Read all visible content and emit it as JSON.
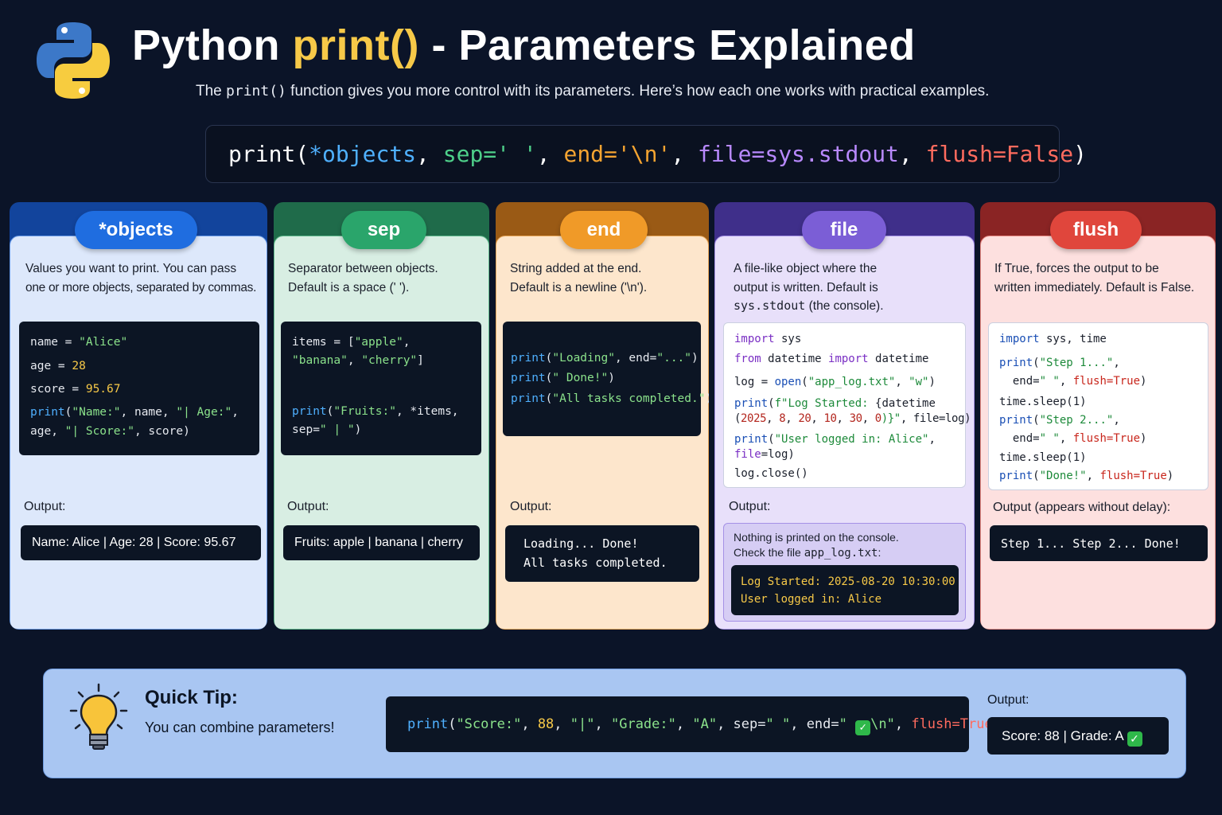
{
  "header": {
    "title_prefix": "Python ",
    "title_highlight": "print()",
    "title_suffix": " - Parameters Explained",
    "subtitle_pre": "The ",
    "subtitle_code": "print()",
    "subtitle_post": " function gives you more control with its parameters. Here’s how each one works with practical examples."
  },
  "signature": {
    "fn": "print(",
    "p1": "*objects",
    "c1": ", ",
    "p2": "sep=' '",
    "c2": ", ",
    "p3": "end='\\n'",
    "c3": ", ",
    "p4a": "file",
    "p4b": "=sys.stdout",
    "c4": ", ",
    "p5a": "flush",
    "p5b": "=False",
    "close": ")"
  },
  "cards": {
    "objects": {
      "label": "*objects",
      "desc1": "Values you want to print. You can pass",
      "desc2": "one or more objects, separated by commas.",
      "output_label": "Output:",
      "output": "Name: Alice | Age: 28 | Score: 95.67",
      "code": {
        "l1a": "name = ",
        "l1b": "\"Alice\"",
        "l2a": "age = ",
        "l2b": "28",
        "l3a": "score = ",
        "l3b": "95.67",
        "l4a": "print",
        "l4b": "(",
        "l4c": "\"Name:\"",
        "l4d": ", name, ",
        "l4e": "\"| Age:\"",
        "l4f": ",",
        "l5a": "age, ",
        "l5b": "\"| Score:\"",
        "l5c": ", score)"
      }
    },
    "sep": {
      "label": "sep",
      "desc1": "Separator between objects.",
      "desc2": "Default is a space (' ').",
      "output_label": "Output:",
      "output": "Fruits: apple | banana | cherry",
      "code": {
        "l1a": "items = [",
        "l1b": "\"apple\"",
        "l1c": ",",
        "l2a": "\"banana\"",
        "l2b": ", ",
        "l2c": "\"cherry\"",
        "l2d": "]",
        "l3a": "print",
        "l3b": "(",
        "l3c": "\"Fruits:\"",
        "l3d": ", *items,",
        "l4a": "sep=",
        "l4b": "\" | \"",
        "l4c": ")"
      }
    },
    "end": {
      "label": "end",
      "desc1": "String added at the end.",
      "desc2": "Default is a newline ('\\n').",
      "output_label": "Output:",
      "output1": "Loading... Done!",
      "output2": "All tasks completed.",
      "code": {
        "l1a": "print",
        "l1b": "(",
        "l1c": "\"Loading\"",
        "l1d": ", end=",
        "l1e": "\"...\"",
        "l1f": ")",
        "l2a": "print",
        "l2b": "(",
        "l2c": "\" Done!\"",
        "l2d": ")",
        "l3a": "print",
        "l3b": "(",
        "l3c": "\"All tasks completed.\"",
        "l3d": ")"
      }
    },
    "file": {
      "label": "file",
      "desc1": "A file-like object where the",
      "desc2": "output is written. Default is",
      "desc3a": "sys.stdout",
      "desc3b": " (the console).",
      "output_label": "Output:",
      "note1": "Nothing is printed on the console.",
      "note2a": "Check the file ",
      "note2b": "app_log.txt",
      "note2c": ":",
      "log1": "Log Started: 2025-08-20 10:30:00",
      "log2": "User logged in: Alice",
      "code": {
        "l1a": "import",
        "l1b": " sys",
        "l2a": "from",
        "l2b": " datetime ",
        "l2c": "import",
        "l2d": " datetime",
        "l3a": "log = ",
        "l3b": "open",
        "l3c": "(",
        "l3d": "\"app_log.txt\"",
        "l3e": ", ",
        "l3f": "\"w\"",
        "l3g": ")",
        "l4a": "print",
        "l4b": "(",
        "l4c": "f\"Log Started: ",
        "l4d": "{datetime",
        "l5a": "(",
        "l5b": "2025",
        "l5c": ", ",
        "l5d": "8",
        "l5e": ", ",
        "l5f": "20",
        "l5g": ", ",
        "l5h": "10",
        "l5i": ", ",
        "l5j": "30",
        "l5k": ", ",
        "l5l": "0",
        "l5m": ")}\"",
        "l5n": ", file=log)",
        "l6a": "print",
        "l6b": "(",
        "l6c": "\"User logged in: Alice\"",
        "l6d": ",",
        "l7a": "file",
        "l7b": "=log)",
        "l8a": "log.close()"
      }
    },
    "flush": {
      "label": "flush",
      "desc1": "If True, forces the output to be",
      "desc2": "written immediately. Default is False.",
      "output_label": "Output (appears without delay):",
      "output": "Step 1... Step 2... Done!",
      "code": {
        "l1a": "import",
        "l1b": " sys, time",
        "l2a": "print",
        "l2b": "(",
        "l2c": "\"Step 1...\"",
        "l2d": ",",
        "l3a": "  end=",
        "l3b": "\" \"",
        "l3c": ", ",
        "l3d": "flush",
        "l3e": "=True",
        "l3f": ")",
        "l4a": "time.sleep(1)",
        "l5a": "print",
        "l5b": "(",
        "l5c": "\"Step 2...\"",
        "l5d": ",",
        "l6a": "  end=",
        "l6b": "\" \"",
        "l6c": ", ",
        "l6d": "flush",
        "l6e": "=True",
        "l6f": ")",
        "l7a": "time.sleep(1)",
        "l8a": "print",
        "l8b": "(",
        "l8c": "\"Done!\"",
        "l8d": ", ",
        "l8e": "flush",
        "l8f": "=True",
        "l8g": ")"
      }
    }
  },
  "tip": {
    "title": "Quick Tip:",
    "text": "You can combine parameters!",
    "code": {
      "a": "print",
      "b": "(",
      "c": "\"Score:\"",
      "d": ", ",
      "e": "88",
      "f": ", ",
      "g": "\"|\"",
      "h": ", ",
      "i": "\"Grade:\"",
      "j": ", ",
      "k": "\"A\"",
      "l": ", sep=",
      "m": "\" \"",
      "n": ", end=",
      "o1": "\" ",
      "o2": "\\n\"",
      "p": ", ",
      "q": "flush",
      "r": "=True",
      "s": ")"
    },
    "output_label": "Output:",
    "output": "Score: 88 | Grade: A "
  },
  "colors": {
    "objects": "#1d63d6",
    "sep": "#2aa56b",
    "end": "#f09a28",
    "file": "#7b5ed6",
    "flush": "#e0463c"
  }
}
